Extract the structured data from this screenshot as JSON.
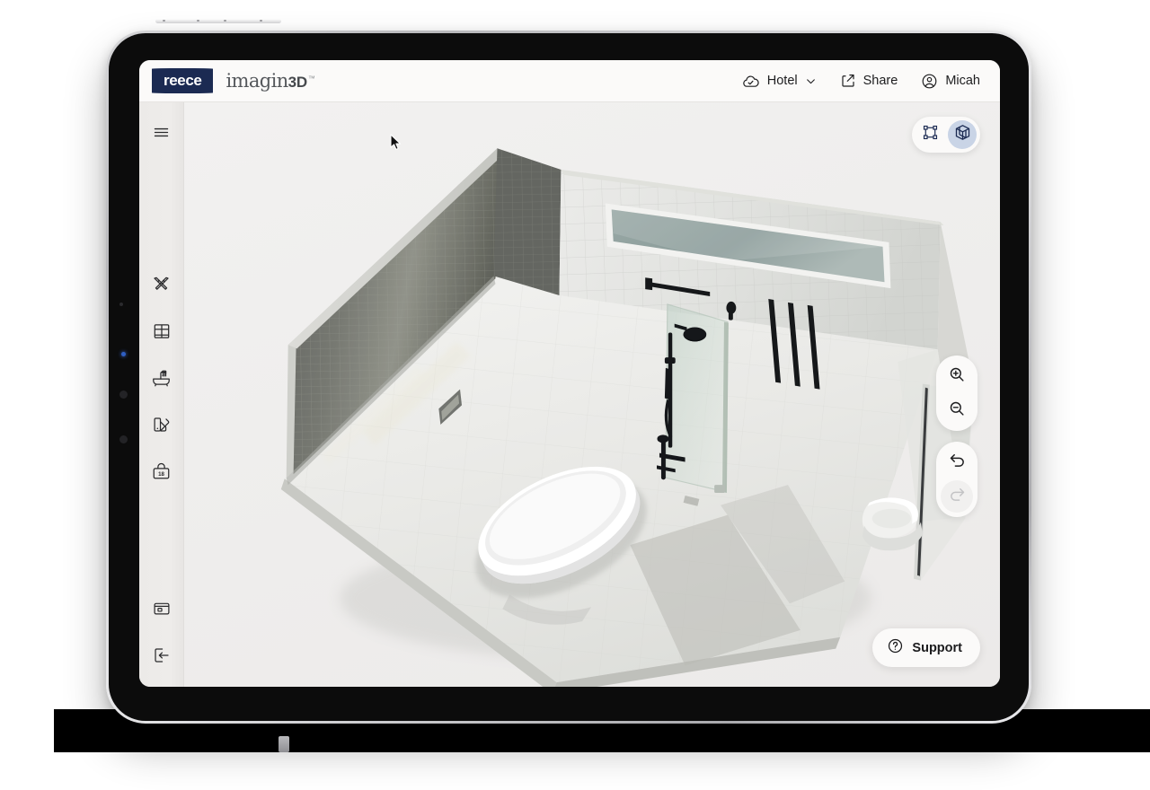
{
  "app": {
    "brand_logo": "reece",
    "brand_name_primary": "imagin",
    "brand_name_secondary": "3D",
    "brand_trademark": "™"
  },
  "header": {
    "save_status": {
      "label": "Hotel",
      "icon": "cloud-check-icon",
      "chevron": "chevron-down-icon"
    },
    "share": {
      "label": "Share",
      "icon": "share-icon"
    },
    "account": {
      "label": "Micah",
      "icon": "user-circle-icon"
    }
  },
  "sidebar": {
    "menu": {
      "name": "hamburger-menu",
      "icon": "hamburger-icon"
    },
    "items": [
      {
        "name": "design-tools",
        "icon": "pencil-ruler-icon",
        "label": "Design"
      },
      {
        "name": "room-layout",
        "icon": "window-grid-icon",
        "label": "Room"
      },
      {
        "name": "fixtures",
        "icon": "bathtub-shower-icon",
        "label": "Fixtures"
      },
      {
        "name": "finishes",
        "icon": "color-swatch-icon",
        "label": "Finishes"
      },
      {
        "name": "cart",
        "icon": "shopping-bag-icon",
        "label": "Cart",
        "badge": "18"
      }
    ],
    "bottom_items": [
      {
        "name": "snapshot",
        "icon": "camera-icon",
        "label": "Snapshot"
      },
      {
        "name": "exit",
        "icon": "exit-icon",
        "label": "Exit"
      }
    ]
  },
  "viewport": {
    "view_toggle": {
      "options": [
        {
          "name": "view-2d",
          "icon": "plan-2d-icon",
          "label": "2D",
          "active": false
        },
        {
          "name": "view-3d",
          "icon": "cube-3d-icon",
          "label": "3D",
          "active": true
        }
      ]
    },
    "zoom_controls": [
      {
        "name": "zoom-in",
        "icon": "magnifier-plus-icon",
        "label": "Zoom in",
        "disabled": false
      },
      {
        "name": "zoom-out",
        "icon": "magnifier-minus-icon",
        "label": "Zoom out",
        "disabled": false
      }
    ],
    "history_controls": [
      {
        "name": "undo",
        "icon": "undo-arrow-icon",
        "label": "Undo",
        "disabled": false
      },
      {
        "name": "redo",
        "icon": "redo-arrow-icon",
        "label": "Redo",
        "disabled": true
      }
    ],
    "support": {
      "label": "Support",
      "icon": "question-circle-icon"
    },
    "scene_description": "3D bathroom render: dark grey mosaic tiled feature wall, white square tiled wall, freestanding white oval bathtub, glass shower screen with matte black rail shower, black towel rails, wall-hung toilet, light marble tile floor"
  },
  "colors": {
    "brand_navy": "#1b2a52",
    "toggle_active_bg": "#c9d4e6",
    "canvas_bg": "#f0efee",
    "header_bg": "#fbfaf9",
    "sidebar_bg": "#eceae8",
    "bezel": "#0c0c0c"
  }
}
